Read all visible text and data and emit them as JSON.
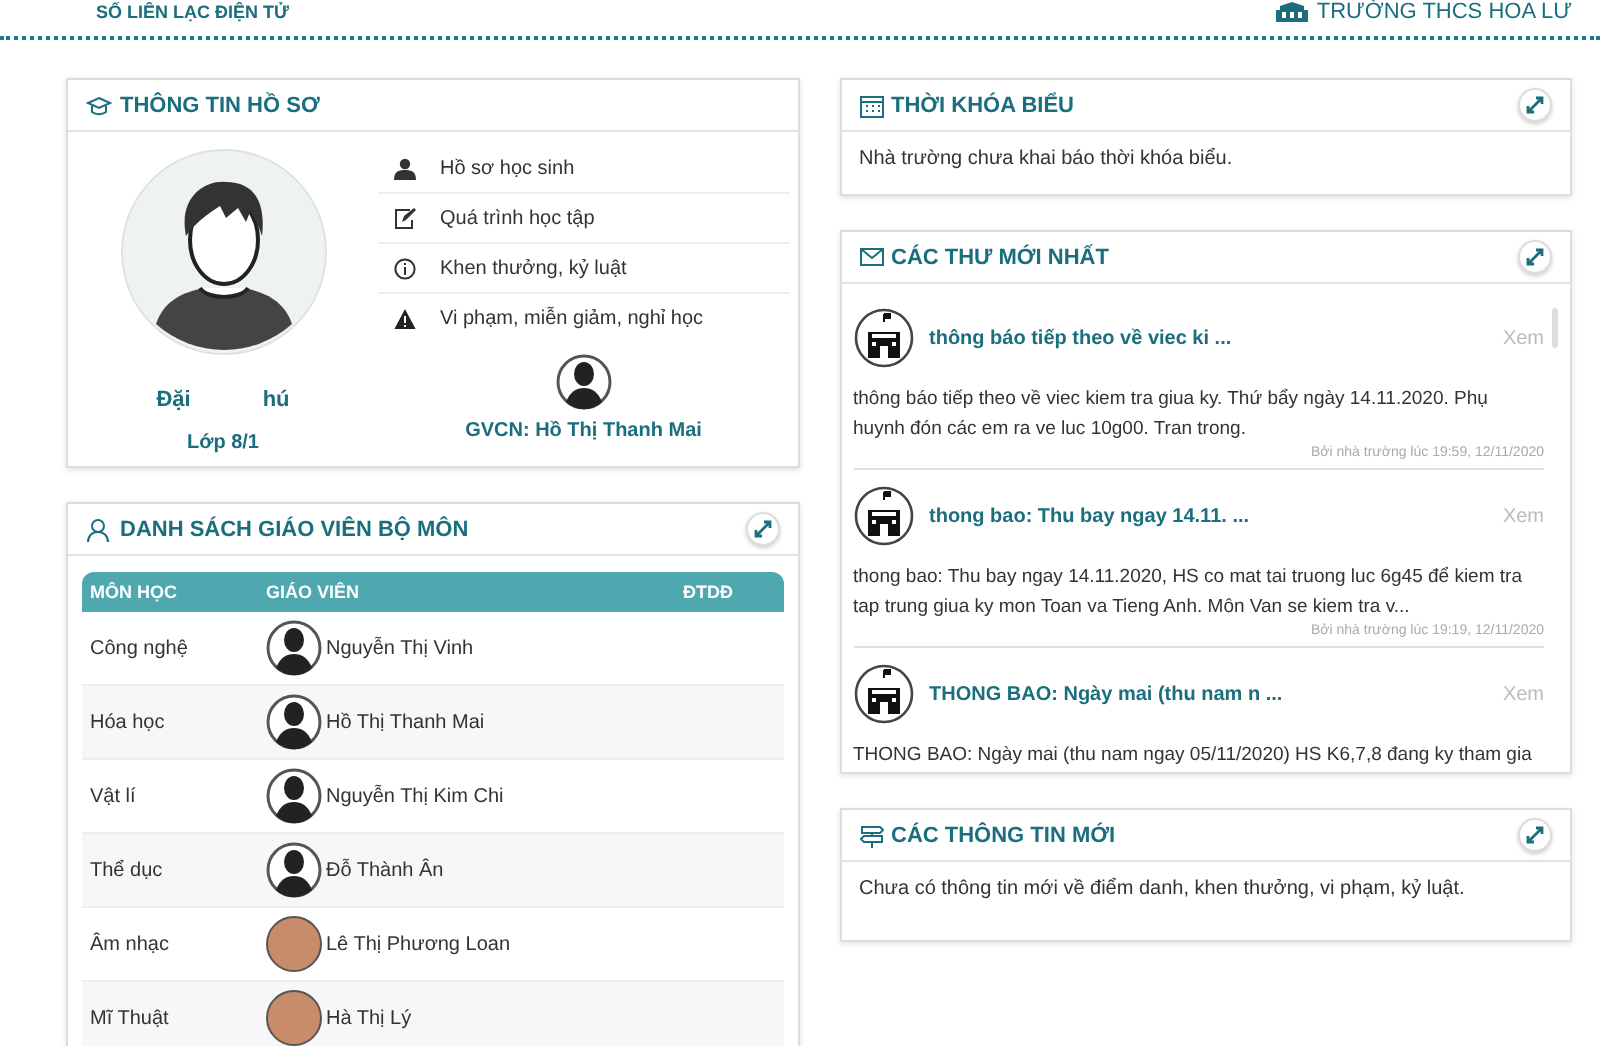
{
  "header": {
    "app_title": "SỐ LIÊN LẠC ĐIỆN TỬ",
    "school": "TRƯỜNG THCS HOA LƯ"
  },
  "profile": {
    "title": "THÔNG TIN HỒ SƠ",
    "name_parts": [
      "Đặi",
      "hú"
    ],
    "class": "Lớp 8/1",
    "menu": [
      {
        "kind": "user",
        "label": "Hồ sơ học sinh"
      },
      {
        "kind": "edit",
        "label": "Quá trình học tập"
      },
      {
        "kind": "info",
        "label": "Khen thưởng, kỷ luật"
      },
      {
        "kind": "warning",
        "label": "Vi phạm, miễn giảm, nghỉ học"
      }
    ],
    "homeroom": "GVCN: Hồ Thị Thanh Mai"
  },
  "teachers": {
    "title": "DANH SÁCH GIÁO VIÊN BỘ MÔN",
    "columns": [
      "MÔN HỌC",
      "GIÁO VIÊN",
      "ĐTDĐ"
    ],
    "rows": [
      {
        "subject": "Công nghệ",
        "teacher": "Nguyễn Thị Vinh",
        "kind": "silhouette"
      },
      {
        "subject": "Hóa học",
        "teacher": "Hồ Thị Thanh Mai",
        "kind": "silhouette"
      },
      {
        "subject": "Vật lí",
        "teacher": "Nguyễn Thị Kim Chi",
        "kind": "silhouette"
      },
      {
        "subject": "Thể dục",
        "teacher": "Đỗ Thành Ân",
        "kind": "silhouette"
      },
      {
        "subject": "Âm nhạc",
        "teacher": "Lê Thị Phương Loan",
        "kind": "photo"
      },
      {
        "subject": "Mĩ Thuật",
        "teacher": "Hà Thị Lý",
        "kind": "photo"
      }
    ]
  },
  "timetable": {
    "title": "THỜI KHÓA BIỂU",
    "message": "Nhà trường chưa khai báo thời khóa biểu."
  },
  "messages": {
    "title": "CÁC THƯ MỚI NHẤT",
    "items": [
      {
        "subject": "thông báo tiếp theo về viec ki ...",
        "action": "Xem",
        "body": "thông báo tiếp theo về viec kiem tra giua ky. Thứ bẩy ngày 14.11.2020. Phụ huynh đón các em ra ve luc 10g00. Tran trong.",
        "meta": "Bởi nhà trường lúc 19:59, 12/11/2020"
      },
      {
        "subject": "thong bao: Thu bay ngay 14.11. ...",
        "action": "Xem",
        "body": "thong bao: Thu bay ngay 14.11.2020, HS co mat tai truong luc 6g45 để kiem tra tap trung giua ky mon Toan va Tieng Anh. Môn Van se kiem tra v...",
        "meta": "Bởi nhà trường lúc 19:19, 12/11/2020"
      },
      {
        "subject": "THONG BAO: Ngày mai (thu nam n ...",
        "action": "Xem",
        "body": "THONG BAO: Ngày mai (thu nam ngay 05/11/2020) HS K6,7,8 đang ky tham gia"
      }
    ]
  },
  "news": {
    "title": "CÁC THÔNG TIN MỚI",
    "message": "Chưa có thông tin mới về điểm danh, khen thưởng, vi phạm, kỷ luật."
  }
}
